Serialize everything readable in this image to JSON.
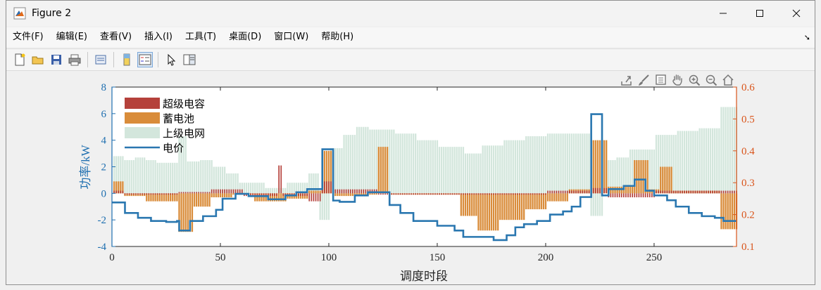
{
  "window": {
    "title": "Figure 2"
  },
  "menu": [
    {
      "key": "file",
      "label": "文件(F)"
    },
    {
      "key": "edit",
      "label": "编辑(E)"
    },
    {
      "key": "view",
      "label": "查看(V)"
    },
    {
      "key": "insert",
      "label": "插入(I)"
    },
    {
      "key": "tools",
      "label": "工具(T)"
    },
    {
      "key": "desktop",
      "label": "桌面(D)"
    },
    {
      "key": "window",
      "label": "窗口(W)"
    },
    {
      "key": "help",
      "label": "帮助(H)"
    }
  ],
  "toolbar_icons": [
    "new-figure-icon",
    "open-icon",
    "save-icon",
    "print-icon",
    "print-preview-icon",
    "colorbar-icon",
    "legend-icon",
    "pointer-icon",
    "property-editor-icon"
  ],
  "axes_toolbar_icons": [
    "export-icon",
    "brush-icon",
    "datatip-icon",
    "pan-hand-icon",
    "zoom-in-icon",
    "zoom-out-icon",
    "home-icon"
  ],
  "colors": {
    "supercap": "#b5413b",
    "battery": "#d98c3a",
    "grid": "#d3e6dc",
    "price": "#2a77b0",
    "left_axis": "#1f6fb0",
    "right_axis": "#d9541a"
  },
  "chart_data": {
    "type": "bar",
    "xlabel": "调度时段",
    "ylabel_left": "功率/kW",
    "xlim": [
      0,
      288
    ],
    "ylim_left": [
      -4,
      8
    ],
    "ylim_right": [
      0.1,
      0.6
    ],
    "xticks": [
      "0",
      "50",
      "100",
      "150",
      "200",
      "250"
    ],
    "yticks_left": [
      "-4",
      "-2",
      "0",
      "2",
      "4",
      "6",
      "8"
    ],
    "yticks_right": [
      "0.1",
      "0.2",
      "0.3",
      "0.4",
      "0.5",
      "0.6"
    ],
    "legend": [
      "超级电容",
      "蓄电池",
      "上级电网",
      "电价"
    ],
    "legend_placement": "top-left",
    "series_grid_segments": [
      {
        "from": 1,
        "to": 5,
        "value": 2.8
      },
      {
        "from": 6,
        "to": 10,
        "value": 2.5
      },
      {
        "from": 11,
        "to": 15,
        "value": 2.7
      },
      {
        "from": 16,
        "to": 20,
        "value": 2.5
      },
      {
        "from": 21,
        "to": 30,
        "value": 2.3
      },
      {
        "from": 31,
        "to": 34,
        "value": 4.3
      },
      {
        "from": 35,
        "to": 40,
        "value": 2.4
      },
      {
        "from": 41,
        "to": 46,
        "value": 2.5
      },
      {
        "from": 47,
        "to": 52,
        "value": 2.0
      },
      {
        "from": 53,
        "to": 58,
        "value": 1.5
      },
      {
        "from": 59,
        "to": 70,
        "value": 0.8
      },
      {
        "from": 71,
        "to": 80,
        "value": 0.4
      },
      {
        "from": 81,
        "to": 90,
        "value": 0.8
      },
      {
        "from": 91,
        "to": 95,
        "value": 1.5
      },
      {
        "from": 96,
        "to": 100,
        "value": -2.0
      },
      {
        "from": 101,
        "to": 106,
        "value": 3.4
      },
      {
        "from": 107,
        "to": 112,
        "value": 4.4
      },
      {
        "from": 113,
        "to": 118,
        "value": 5.0
      },
      {
        "from": 119,
        "to": 130,
        "value": 4.8
      },
      {
        "from": 131,
        "to": 140,
        "value": 4.5
      },
      {
        "from": 141,
        "to": 150,
        "value": 4.0
      },
      {
        "from": 151,
        "to": 162,
        "value": 3.5
      },
      {
        "from": 163,
        "to": 170,
        "value": 3.0
      },
      {
        "from": 171,
        "to": 180,
        "value": 3.6
      },
      {
        "from": 181,
        "to": 190,
        "value": 4.0
      },
      {
        "from": 191,
        "to": 200,
        "value": 4.3
      },
      {
        "from": 201,
        "to": 212,
        "value": 4.5
      },
      {
        "from": 213,
        "to": 220,
        "value": 4.5
      },
      {
        "from": 221,
        "to": 226,
        "value": -1.7
      },
      {
        "from": 227,
        "to": 232,
        "value": 2.5
      },
      {
        "from": 233,
        "to": 238,
        "value": 2.7
      },
      {
        "from": 239,
        "to": 250,
        "value": 3.3
      },
      {
        "from": 251,
        "to": 260,
        "value": 4.4
      },
      {
        "from": 261,
        "to": 270,
        "value": 4.7
      },
      {
        "from": 271,
        "to": 280,
        "value": 4.9
      },
      {
        "from": 281,
        "to": 288,
        "value": 6.5
      }
    ],
    "series_battery_segments": [
      {
        "from": 1,
        "to": 5,
        "value": 0.9
      },
      {
        "from": 6,
        "to": 15,
        "value": -0.2
      },
      {
        "from": 16,
        "to": 30,
        "value": -0.6
      },
      {
        "from": 31,
        "to": 37,
        "value": -2.9
      },
      {
        "from": 38,
        "to": 45,
        "value": -1.0
      },
      {
        "from": 46,
        "to": 55,
        "value": -0.3
      },
      {
        "from": 56,
        "to": 65,
        "value": -0.1
      },
      {
        "from": 66,
        "to": 80,
        "value": -0.6
      },
      {
        "from": 81,
        "to": 90,
        "value": -0.4
      },
      {
        "from": 91,
        "to": 96,
        "value": 0.2
      },
      {
        "from": 97,
        "to": 102,
        "value": 3.2
      },
      {
        "from": 103,
        "to": 112,
        "value": -0.2
      },
      {
        "from": 113,
        "to": 122,
        "value": -0.1
      },
      {
        "from": 123,
        "to": 127,
        "value": 3.5
      },
      {
        "from": 128,
        "to": 160,
        "value": -0.1
      },
      {
        "from": 161,
        "to": 168,
        "value": -1.7
      },
      {
        "from": 169,
        "to": 178,
        "value": -2.8
      },
      {
        "from": 179,
        "to": 190,
        "value": -2.0
      },
      {
        "from": 191,
        "to": 200,
        "value": -1.2
      },
      {
        "from": 201,
        "to": 210,
        "value": -0.6
      },
      {
        "from": 211,
        "to": 220,
        "value": 0.3
      },
      {
        "from": 221,
        "to": 228,
        "value": 4.0
      },
      {
        "from": 229,
        "to": 240,
        "value": 0.5
      },
      {
        "from": 241,
        "to": 247,
        "value": 2.5
      },
      {
        "from": 248,
        "to": 252,
        "value": 0.3
      },
      {
        "from": 253,
        "to": 258,
        "value": 2.0
      },
      {
        "from": 259,
        "to": 280,
        "value": 0.2
      },
      {
        "from": 281,
        "to": 288,
        "value": -2.7
      }
    ],
    "series_supercap_segments": [
      {
        "from": 1,
        "to": 5,
        "value": 0.2
      },
      {
        "from": 6,
        "to": 30,
        "value": -0.1
      },
      {
        "from": 31,
        "to": 45,
        "value": 0.1
      },
      {
        "from": 46,
        "to": 60,
        "value": 0.3
      },
      {
        "from": 61,
        "to": 76,
        "value": -0.2
      },
      {
        "from": 77,
        "to": 78,
        "value": 2.1
      },
      {
        "from": 79,
        "to": 90,
        "value": -0.2
      },
      {
        "from": 91,
        "to": 96,
        "value": -0.6
      },
      {
        "from": 97,
        "to": 102,
        "value": 0.9
      },
      {
        "from": 103,
        "to": 122,
        "value": 0.3
      },
      {
        "from": 123,
        "to": 160,
        "value": -0.1
      },
      {
        "from": 161,
        "to": 200,
        "value": -0.1
      },
      {
        "from": 201,
        "to": 220,
        "value": 0.2
      },
      {
        "from": 221,
        "to": 228,
        "value": 0.4
      },
      {
        "from": 229,
        "to": 250,
        "value": -0.3
      },
      {
        "from": 251,
        "to": 288,
        "value": 0.2
      }
    ],
    "series_price_steps": [
      {
        "from": 0,
        "to": 6,
        "value": 0.238
      },
      {
        "from": 6,
        "to": 12,
        "value": 0.205
      },
      {
        "from": 12,
        "to": 18,
        "value": 0.19
      },
      {
        "from": 18,
        "to": 25,
        "value": 0.18
      },
      {
        "from": 25,
        "to": 30,
        "value": 0.177
      },
      {
        "from": 30,
        "to": 31,
        "value": 0.18
      },
      {
        "from": 31,
        "to": 36,
        "value": 0.15
      },
      {
        "from": 36,
        "to": 42,
        "value": 0.18
      },
      {
        "from": 42,
        "to": 48,
        "value": 0.195
      },
      {
        "from": 48,
        "to": 51,
        "value": 0.215
      },
      {
        "from": 51,
        "to": 57,
        "value": 0.25
      },
      {
        "from": 57,
        "to": 63,
        "value": 0.265
      },
      {
        "from": 63,
        "to": 72,
        "value": 0.258
      },
      {
        "from": 72,
        "to": 80,
        "value": 0.248
      },
      {
        "from": 80,
        "to": 85,
        "value": 0.26
      },
      {
        "from": 85,
        "to": 90,
        "value": 0.27
      },
      {
        "from": 90,
        "to": 97,
        "value": 0.28
      },
      {
        "from": 97,
        "to": 102,
        "value": 0.405
      },
      {
        "from": 102,
        "to": 105,
        "value": 0.244
      },
      {
        "from": 105,
        "to": 112,
        "value": 0.24
      },
      {
        "from": 112,
        "to": 118,
        "value": 0.26
      },
      {
        "from": 118,
        "to": 125,
        "value": 0.27
      },
      {
        "from": 125,
        "to": 128,
        "value": 0.27
      },
      {
        "from": 128,
        "to": 133,
        "value": 0.23
      },
      {
        "from": 133,
        "to": 139,
        "value": 0.205
      },
      {
        "from": 139,
        "to": 150,
        "value": 0.18
      },
      {
        "from": 150,
        "to": 158,
        "value": 0.165
      },
      {
        "from": 158,
        "to": 162,
        "value": 0.15
      },
      {
        "from": 162,
        "to": 176,
        "value": 0.13
      },
      {
        "from": 176,
        "to": 182,
        "value": 0.12
      },
      {
        "from": 182,
        "to": 186,
        "value": 0.135
      },
      {
        "from": 186,
        "to": 190,
        "value": 0.16
      },
      {
        "from": 190,
        "to": 196,
        "value": 0.17
      },
      {
        "from": 196,
        "to": 202,
        "value": 0.18
      },
      {
        "from": 202,
        "to": 208,
        "value": 0.2
      },
      {
        "from": 208,
        "to": 212,
        "value": 0.21
      },
      {
        "from": 212,
        "to": 216,
        "value": 0.225
      },
      {
        "from": 216,
        "to": 221,
        "value": 0.255
      },
      {
        "from": 221,
        "to": 226,
        "value": 0.515
      },
      {
        "from": 226,
        "to": 229,
        "value": 0.26
      },
      {
        "from": 229,
        "to": 236,
        "value": 0.28
      },
      {
        "from": 236,
        "to": 241,
        "value": 0.29
      },
      {
        "from": 241,
        "to": 246,
        "value": 0.31
      },
      {
        "from": 246,
        "to": 250,
        "value": 0.275
      },
      {
        "from": 250,
        "to": 256,
        "value": 0.26
      },
      {
        "from": 256,
        "to": 260,
        "value": 0.245
      },
      {
        "from": 260,
        "to": 266,
        "value": 0.225
      },
      {
        "from": 266,
        "to": 272,
        "value": 0.205
      },
      {
        "from": 272,
        "to": 278,
        "value": 0.195
      },
      {
        "from": 278,
        "to": 282,
        "value": 0.19
      },
      {
        "from": 282,
        "to": 288,
        "value": 0.18
      }
    ]
  }
}
